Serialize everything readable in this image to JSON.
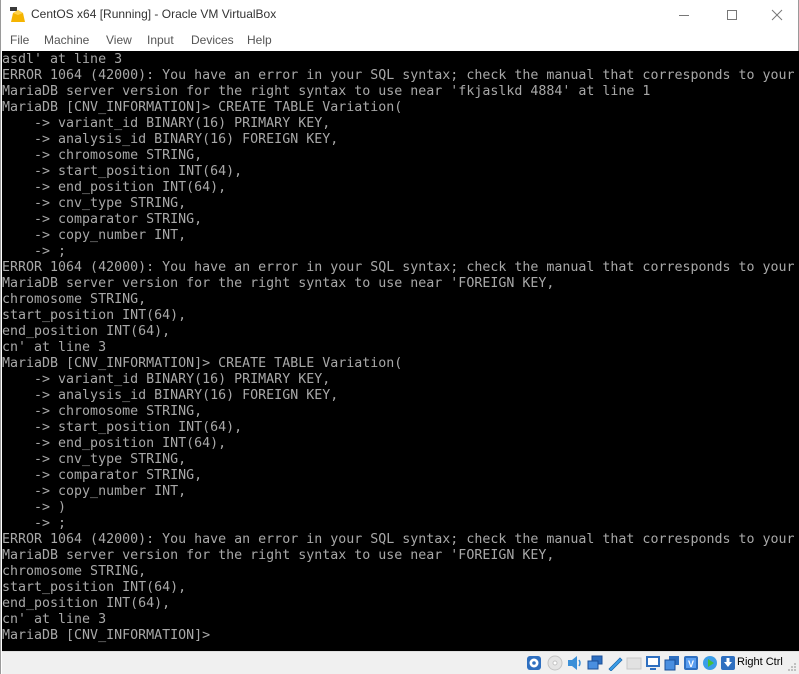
{
  "window": {
    "title": "CentOS x64 [Running] - Oracle VM VirtualBox",
    "app_icon": "virtualbox-vm-icon",
    "controls": [
      "minimize-icon",
      "maximize-icon",
      "close-icon"
    ]
  },
  "menu": {
    "items": [
      {
        "label": "File"
      },
      {
        "label": "Machine"
      },
      {
        "label": "View"
      },
      {
        "label": "Input"
      },
      {
        "label": "Devices"
      },
      {
        "label": "Help"
      }
    ]
  },
  "console": {
    "lines": [
      "asdl' at line 3",
      "ERROR 1064 (42000): You have an error in your SQL syntax; check the manual that corresponds to your",
      "MariaDB server version for the right syntax to use near 'fkjaslkd 4884' at line 1",
      "MariaDB [CNV_INFORMATION]> CREATE TABLE Variation(",
      "    -> variant_id BINARY(16) PRIMARY KEY,",
      "    -> analysis_id BINARY(16) FOREIGN KEY,",
      "    -> chromosome STRING,",
      "    -> start_position INT(64),",
      "    -> end_position INT(64),",
      "    -> cnv_type STRING,",
      "    -> comparator STRING,",
      "    -> copy_number INT,",
      "    -> ;",
      "ERROR 1064 (42000): You have an error in your SQL syntax; check the manual that corresponds to your",
      "MariaDB server version for the right syntax to use near 'FOREIGN KEY,",
      "chromosome STRING,",
      "start_position INT(64),",
      "end_position INT(64),",
      "cn' at line 3",
      "MariaDB [CNV_INFORMATION]> CREATE TABLE Variation(",
      "    -> variant_id BINARY(16) PRIMARY KEY,",
      "    -> analysis_id BINARY(16) FOREIGN KEY,",
      "    -> chromosome STRING,",
      "    -> start_position INT(64),",
      "    -> end_position INT(64),",
      "    -> cnv_type STRING,",
      "    -> comparator STRING,",
      "    -> copy_number INT,",
      "    -> )",
      "    -> ;",
      "ERROR 1064 (42000): You have an error in your SQL syntax; check the manual that corresponds to your",
      "MariaDB server version for the right syntax to use near 'FOREIGN KEY,",
      "chromosome STRING,",
      "start_position INT(64),",
      "end_position INT(64),",
      "cn' at line 3",
      "MariaDB [CNV_INFORMATION]> "
    ]
  },
  "statusbar": {
    "icons": [
      "hard-disk-icon",
      "optical-drive-icon",
      "audio-icon",
      "network-icon",
      "usb-icon",
      "shared-folders-icon",
      "display-icon",
      "video-capture-icon",
      "cpu-virtualization-icon",
      "mouse-integration-icon",
      "keyboard-capture-icon"
    ],
    "host_key": "Right Ctrl"
  },
  "colors": {
    "console_bg": "#000000",
    "console_fg": "#a8a8a8",
    "chrome_bg": "#ffffff",
    "statusbar_bg": "#f0f0f0"
  }
}
